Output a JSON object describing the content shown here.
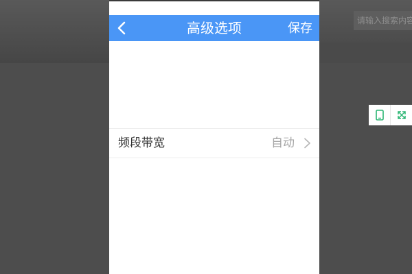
{
  "page": {
    "search_placeholder": "请输入搜索内容"
  },
  "phone": {
    "navbar": {
      "back_icon": "chevron-left-icon",
      "title": "高级选项",
      "save_label": "保存",
      "bg_color": "#4a96f6"
    },
    "settings": [
      {
        "label": "频段带宽",
        "value": "自动",
        "icon": "chevron-right-icon"
      }
    ]
  },
  "tools": [
    {
      "icon": "tablet-icon"
    },
    {
      "icon": "fullscreen-icon"
    }
  ]
}
